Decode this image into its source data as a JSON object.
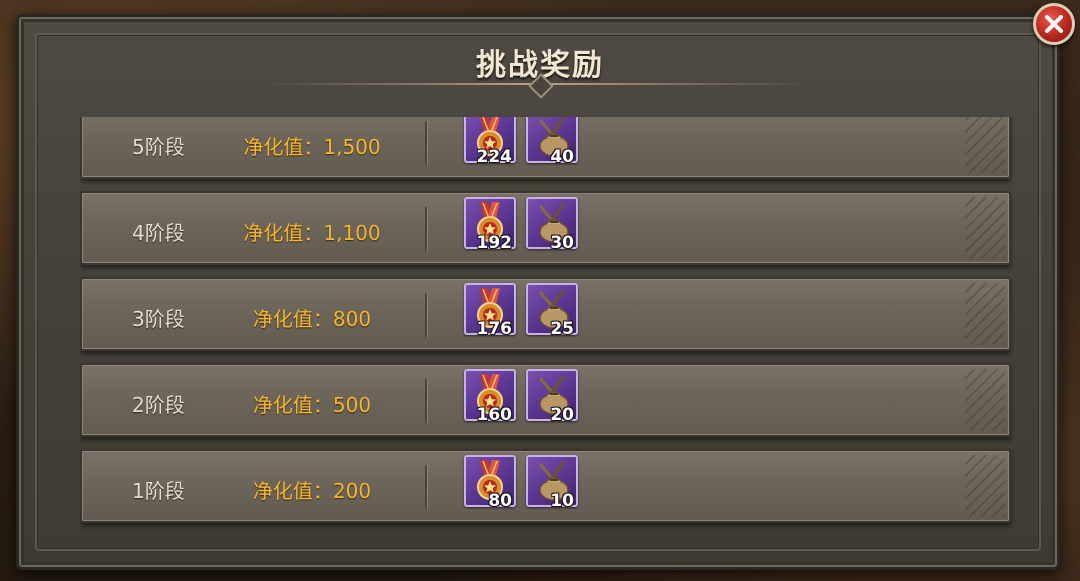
{
  "title": "挑战奖励",
  "close_icon": "close-icon",
  "stages": [
    {
      "stage": "5阶段",
      "purify": "净化值：1,500",
      "rewards": [
        {
          "icon": "medal-icon",
          "qty": "224"
        },
        {
          "icon": "supply-bag-icon",
          "qty": "40"
        }
      ]
    },
    {
      "stage": "4阶段",
      "purify": "净化值：1,100",
      "rewards": [
        {
          "icon": "medal-icon",
          "qty": "192"
        },
        {
          "icon": "supply-bag-icon",
          "qty": "30"
        }
      ]
    },
    {
      "stage": "3阶段",
      "purify": "净化值：800",
      "rewards": [
        {
          "icon": "medal-icon",
          "qty": "176"
        },
        {
          "icon": "supply-bag-icon",
          "qty": "25"
        }
      ]
    },
    {
      "stage": "2阶段",
      "purify": "净化值：500",
      "rewards": [
        {
          "icon": "medal-icon",
          "qty": "160"
        },
        {
          "icon": "supply-bag-icon",
          "qty": "20"
        }
      ]
    },
    {
      "stage": "1阶段",
      "purify": "净化值：200",
      "rewards": [
        {
          "icon": "medal-icon",
          "qty": "80"
        },
        {
          "icon": "supply-bag-icon",
          "qty": "10"
        }
      ]
    }
  ],
  "colors": {
    "purify_text": "#f5b531",
    "reward_frame": "#5a3590",
    "close_button": "#b8271c"
  }
}
